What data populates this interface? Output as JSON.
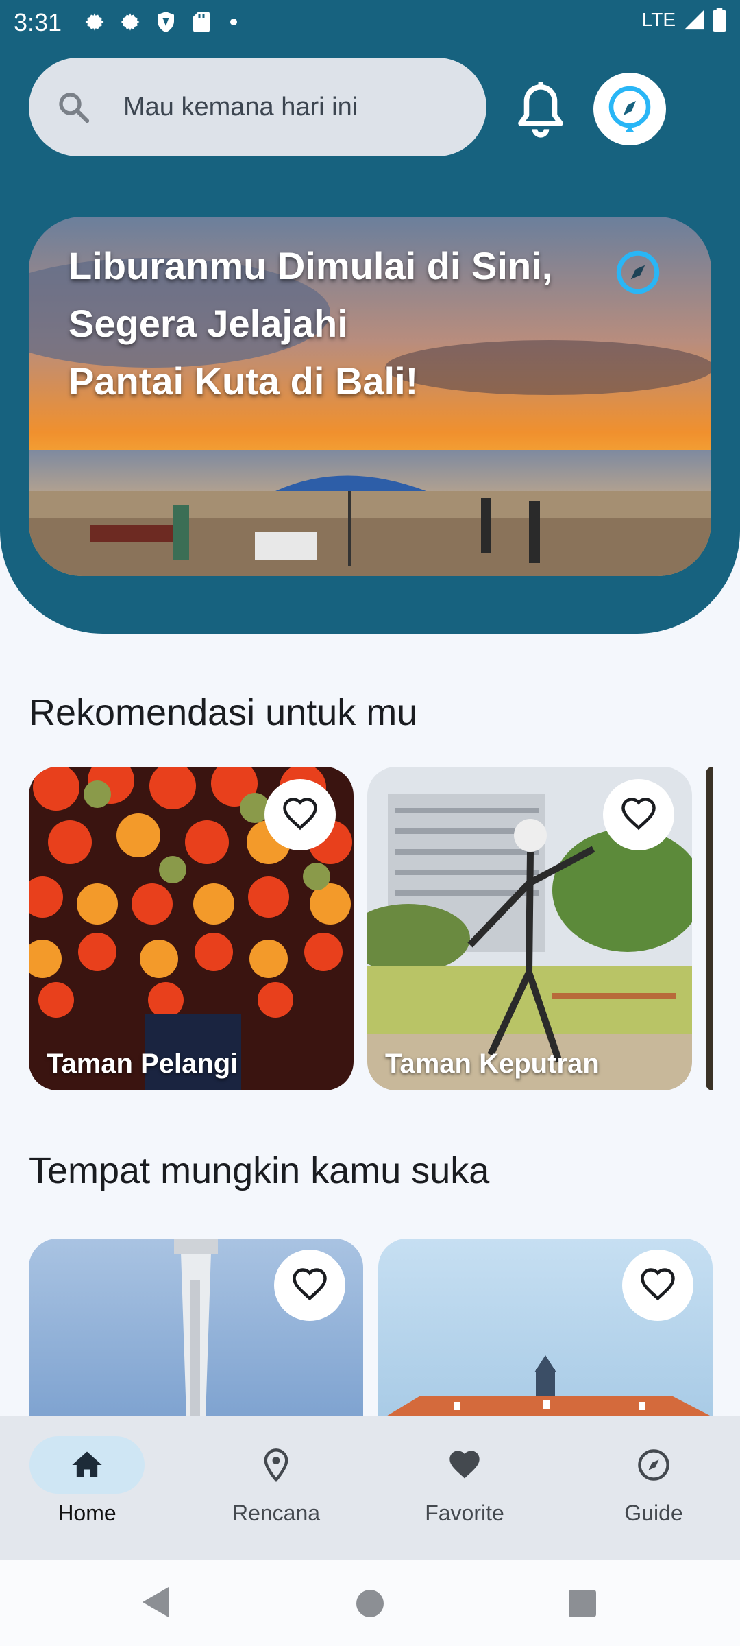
{
  "status_bar": {
    "time": "3:31",
    "network": "LTE"
  },
  "search": {
    "placeholder": "Mau kemana hari ini",
    "icon": "search-icon"
  },
  "header": {
    "bell_icon": "bell-icon",
    "compass_icon": "compass-icon",
    "color": "#17627f"
  },
  "hero": {
    "title_lines": [
      "Liburanmu Dimulai di Sini,",
      "Segera Jelajahi",
      "Pantai Kuta di Bali!"
    ],
    "icon": "compass-icon"
  },
  "sections": {
    "recommend_title": "Rekomendasi untuk mu",
    "maybe_like_title": "Tempat mungkin kamu suka"
  },
  "recommendations": [
    {
      "name": "Taman Pelangi",
      "icon": "heart-outline-icon"
    },
    {
      "name": "Taman Keputran",
      "icon": "heart-outline-icon"
    }
  ],
  "maybe_like": [
    {
      "icon": "heart-outline-icon"
    },
    {
      "icon": "heart-outline-icon"
    }
  ],
  "bottom_nav": [
    {
      "label": "Home",
      "icon": "home-icon",
      "active": true
    },
    {
      "label": "Rencana",
      "icon": "location-pin-icon",
      "active": false
    },
    {
      "label": "Favorite",
      "icon": "heart-icon",
      "active": false
    },
    {
      "label": "Guide",
      "icon": "compass-icon",
      "active": false
    }
  ],
  "colors": {
    "accent": "#29b6f6",
    "nav_active_pill": "#cfe6f4",
    "background": "#f4f7fc"
  }
}
